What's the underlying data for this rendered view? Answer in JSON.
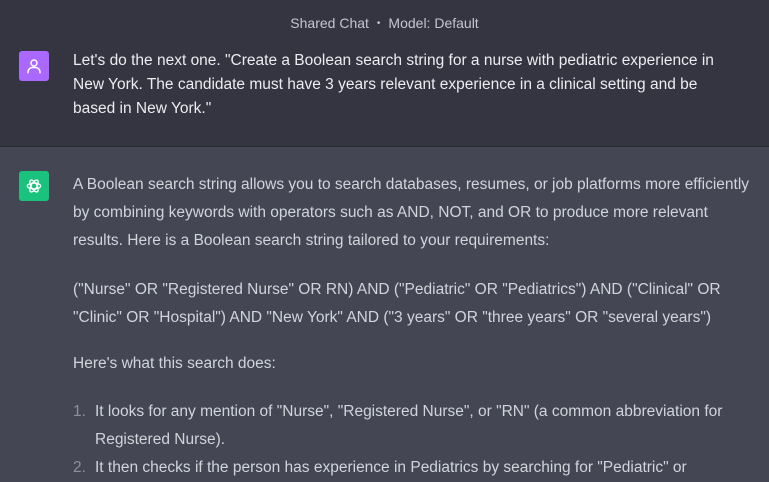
{
  "header": {
    "shared_label": "Shared Chat",
    "separator": "•",
    "model_label": "Model: Default"
  },
  "user_message": {
    "avatar_icon": "user-icon",
    "text": "Let's do the next one. \"Create a Boolean search string for a nurse with pediatric experience in New York. The candidate must have 3 years relevant experience in a clinical setting and be based in New York.\""
  },
  "assistant_message": {
    "avatar_icon": "openai-logo-icon",
    "paragraphs": [
      "A Boolean search string allows you to search databases, resumes, or job platforms more efficiently by combining keywords with operators such as AND, NOT, and OR to produce more relevant results. Here is a Boolean search string tailored to your requirements:",
      "(\"Nurse\" OR \"Registered Nurse\" OR RN) AND (\"Pediatric\" OR \"Pediatrics\") AND (\"Clinical\" OR \"Clinic\" OR \"Hospital\") AND \"New York\" AND (\"3 years\" OR \"three years\" OR \"several years\")",
      "Here's what this search does:"
    ],
    "list": [
      {
        "num": "1.",
        "text": "It looks for any mention of \"Nurse\", \"Registered Nurse\", or \"RN\" (a common abbreviation for Registered Nurse)."
      },
      {
        "num": "2.",
        "text": "It then checks if the person has experience in Pediatrics by searching for \"Pediatric\" or"
      }
    ]
  },
  "colors": {
    "user_bg": "#343541",
    "assistant_bg": "#444654",
    "user_avatar": "#ab68ff",
    "gpt_avatar": "#19c37d"
  }
}
